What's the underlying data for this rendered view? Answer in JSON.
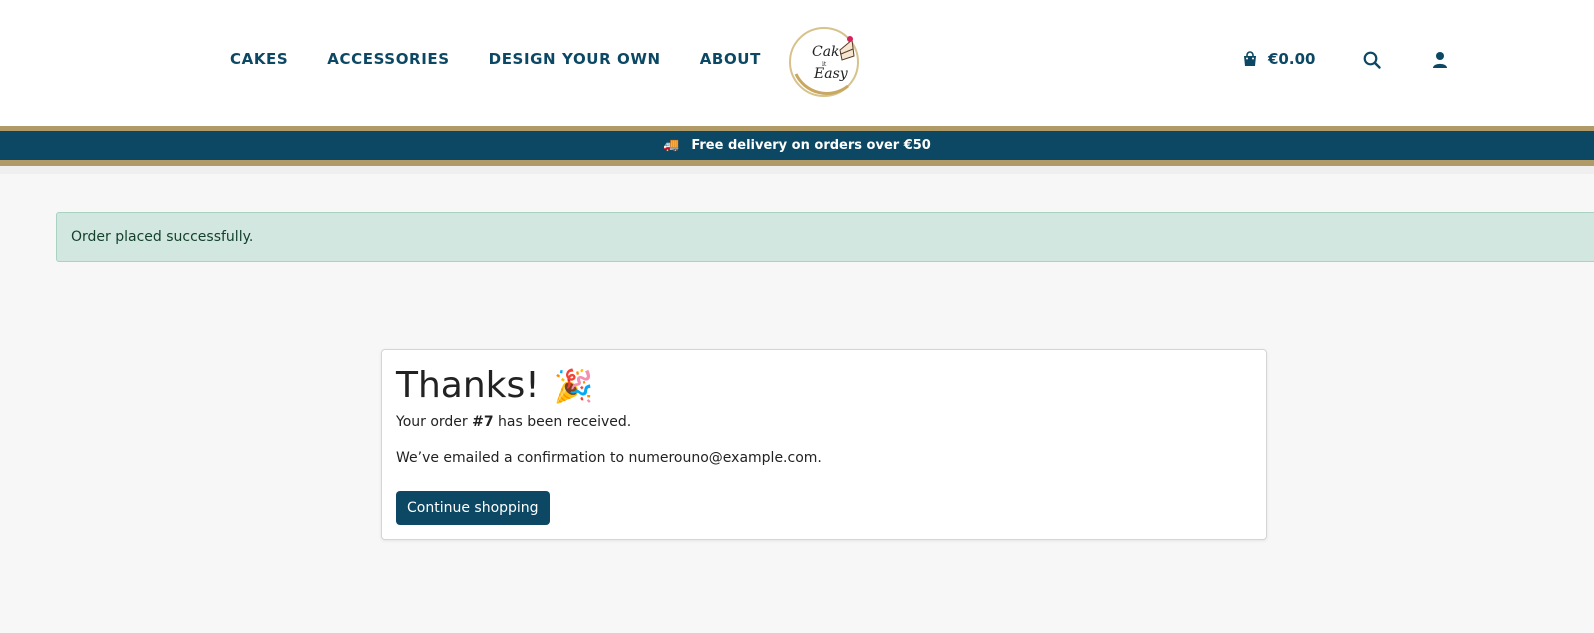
{
  "nav": {
    "items": [
      "CAKES",
      "ACCESSORIES",
      "DESIGN YOUR OWN",
      "ABOUT"
    ]
  },
  "logo": {
    "text_line1": "Cake",
    "text_line2": "it",
    "text_line3": "Easy"
  },
  "header": {
    "cart_total": "€0.00",
    "search_icon": "search-icon",
    "account_icon": "user-icon",
    "cart_icon": "shopping-bag-icon"
  },
  "banner": {
    "text": "Free delivery on orders over €50",
    "icon": "truck-icon"
  },
  "alert": {
    "text": "Order placed successfully."
  },
  "confirmation": {
    "title": "Thanks!",
    "emoji": "🎉",
    "order_prefix": "Your order ",
    "order_number": "#7",
    "order_suffix": " has been received.",
    "email_text": "We’ve emailed a confirmation to numerouno@example.com.",
    "button_label": "Continue shopping"
  },
  "colors": {
    "brand": "#0c4864",
    "gold": "#b09b68",
    "success_bg": "#d2e7df"
  }
}
